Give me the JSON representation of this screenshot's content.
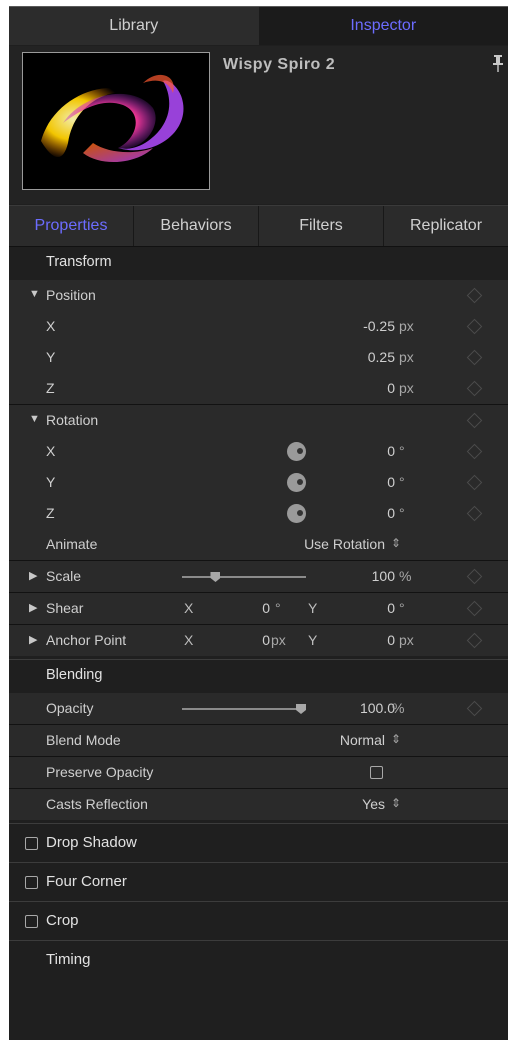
{
  "top_tabs": {
    "library": "Library",
    "inspector": "Inspector"
  },
  "header": {
    "title": "Wispy Spiro 2"
  },
  "sub_tabs": [
    "Properties",
    "Behaviors",
    "Filters",
    "Replicator"
  ],
  "transform": {
    "heading": "Transform",
    "position": {
      "label": "Position",
      "x_label": "X",
      "x": "-0.25",
      "y_label": "Y",
      "y": "0.25",
      "z_label": "Z",
      "z": "0",
      "unit": "px"
    },
    "rotation": {
      "label": "Rotation",
      "x_label": "X",
      "x": "0",
      "y_label": "Y",
      "y": "0",
      "z_label": "Z",
      "z": "0",
      "unit": "°"
    },
    "animate": {
      "label": "Animate",
      "value": "Use Rotation"
    },
    "scale": {
      "label": "Scale",
      "value": "100",
      "unit": "%",
      "slider_fraction": 0.27
    },
    "shear": {
      "label": "Shear",
      "x_label": "X",
      "x": "0",
      "y_label": "Y",
      "y": "0",
      "unit": "°"
    },
    "anchor": {
      "label": "Anchor Point",
      "x_label": "X",
      "x": "0",
      "y_label": "Y",
      "y": "0",
      "unit": "px"
    }
  },
  "blending": {
    "heading": "Blending",
    "opacity": {
      "label": "Opacity",
      "value": "100.0",
      "unit": "%",
      "slider_fraction": 1.0
    },
    "blend_mode": {
      "label": "Blend Mode",
      "value": "Normal"
    },
    "preserve_opacity": {
      "label": "Preserve Opacity",
      "checked": false
    },
    "casts_reflection": {
      "label": "Casts Reflection",
      "value": "Yes"
    }
  },
  "categories": {
    "drop_shadow": "Drop Shadow",
    "four_corner": "Four Corner",
    "crop": "Crop",
    "timing": "Timing"
  },
  "colors": {
    "accent": "#6c6cff",
    "panel": "#1f1f1f"
  }
}
